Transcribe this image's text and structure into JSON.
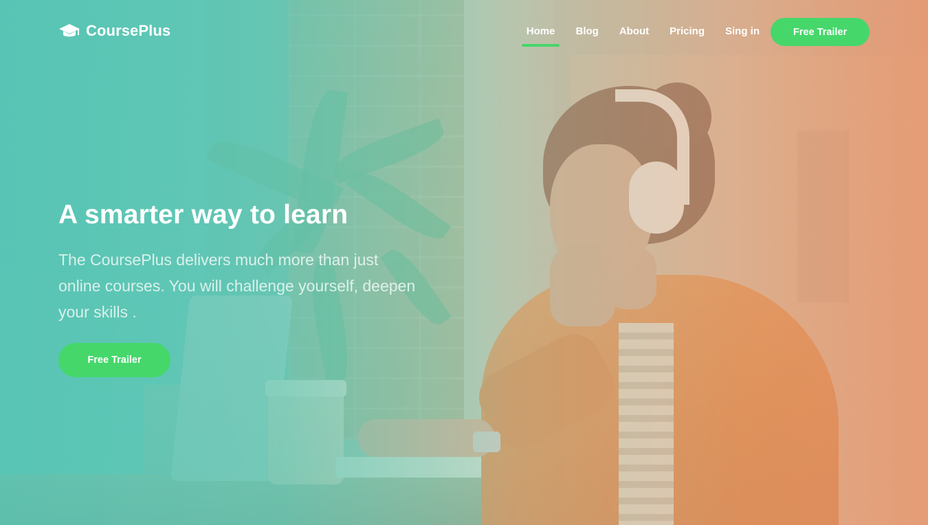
{
  "brand": {
    "name": "CoursePlus",
    "icon": "graduation-cap-icon"
  },
  "nav": {
    "items": [
      {
        "label": "Home",
        "active": true
      },
      {
        "label": "Blog",
        "active": false
      },
      {
        "label": "About",
        "active": false
      },
      {
        "label": "Pricing",
        "active": false
      },
      {
        "label": "Sing in",
        "active": false
      }
    ],
    "cta_label": "Free Trailer"
  },
  "hero": {
    "title": "A smarter way to learn",
    "description": "The CoursePlus delivers much more than just online courses. You will challenge yourself, deepen your skills .",
    "cta_label": "Free Trailer"
  },
  "colors": {
    "accent": "#46d76b",
    "overlay_start": "#54c4b4",
    "overlay_end": "#e6966e",
    "text": "#ffffff"
  }
}
